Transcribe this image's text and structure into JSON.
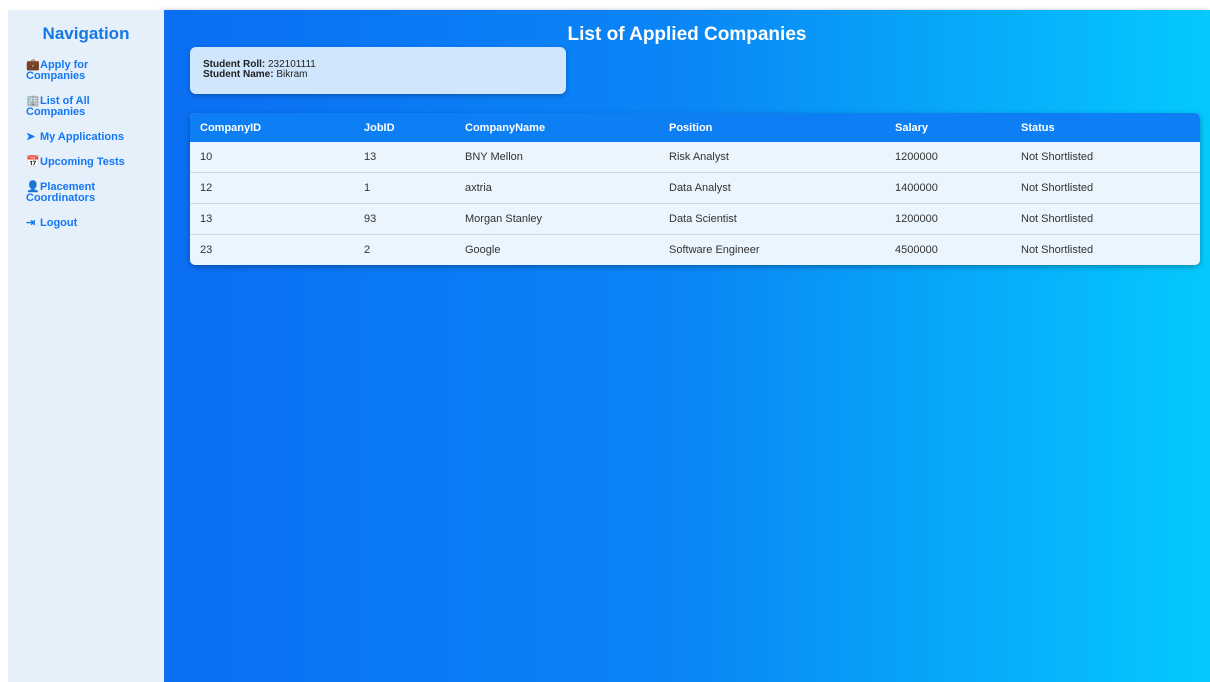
{
  "sidebar": {
    "title": "Navigation",
    "items": [
      {
        "icon": "briefcase-icon",
        "glyph": "💼",
        "label": "Apply for Companies"
      },
      {
        "icon": "building-icon",
        "glyph": "🏢",
        "label": "List of All Companies"
      },
      {
        "icon": "paper-plane-icon",
        "glyph": "➤",
        "label": "My Applications"
      },
      {
        "icon": "calendar-icon",
        "glyph": "📅",
        "label": "Upcoming Tests"
      },
      {
        "icon": "user-tie-icon",
        "glyph": "👤",
        "label": "Placement Coordinators"
      },
      {
        "icon": "logout-icon",
        "glyph": "⇥",
        "label": "Logout"
      }
    ]
  },
  "main": {
    "title": "List of Applied Companies",
    "student": {
      "roll_label": "Student Roll:",
      "roll_value": "232101111",
      "name_label": "Student Name:",
      "name_value": "Bikram"
    },
    "table": {
      "headers": [
        "CompanyID",
        "JobID",
        "CompanyName",
        "Position",
        "Salary",
        "Status"
      ],
      "rows": [
        [
          "10",
          "13",
          "BNY Mellon",
          "Risk Analyst",
          "1200000",
          "Not Shortlisted"
        ],
        [
          "12",
          "1",
          "axtria",
          "Data Analyst",
          "1400000",
          "Not Shortlisted"
        ],
        [
          "13",
          "93",
          "Morgan Stanley",
          "Data Scientist",
          "1200000",
          "Not Shortlisted"
        ],
        [
          "23",
          "2",
          "Google",
          "Software Engineer",
          "4500000",
          "Not Shortlisted"
        ]
      ]
    }
  },
  "colors": {
    "accent": "#1477f5",
    "sidebar_bg": "#e6f0fb",
    "header_row": "#0d7ef4",
    "gradient_start": "#0b6ef3",
    "gradient_end": "#04c9fd"
  }
}
